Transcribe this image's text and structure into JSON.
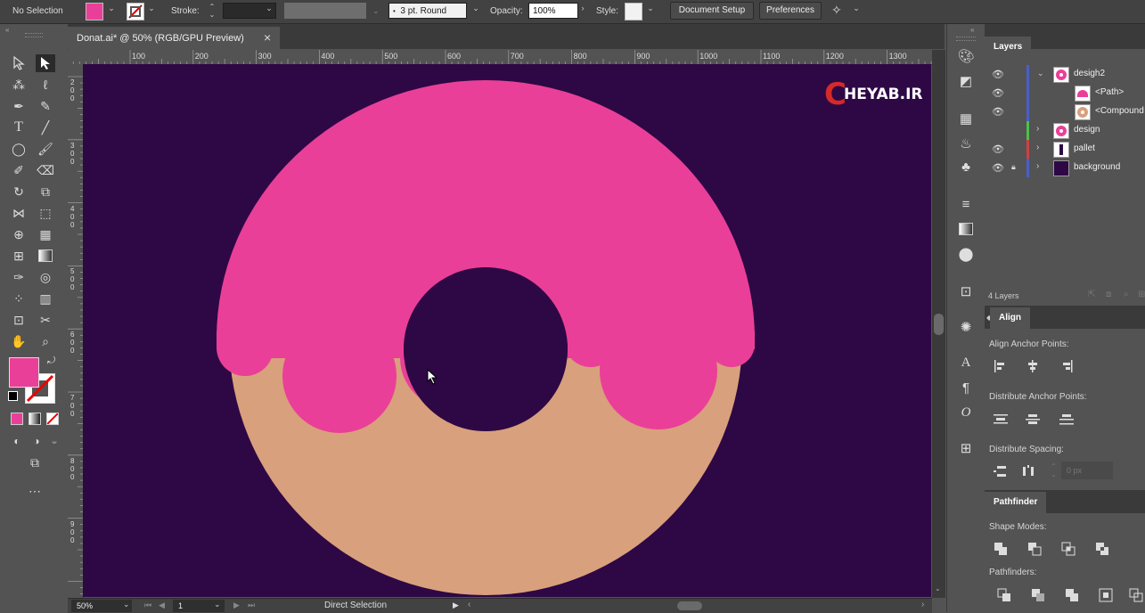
{
  "control_bar": {
    "selection_label": "No Selection",
    "stroke_label": "Stroke:",
    "brush_value": "3 pt. Round",
    "opacity_label": "Opacity:",
    "opacity_value": "100%",
    "style_label": "Style:",
    "document_setup": "Document Setup",
    "preferences": "Preferences",
    "fill_color": "#ea3f98"
  },
  "document_tab": {
    "title": "Donat.ai* @ 50% (RGB/GPU Preview)",
    "close": "×"
  },
  "ruler_top": [
    "100",
    "200",
    "300",
    "400",
    "500",
    "600",
    "700",
    "800",
    "900",
    "1000",
    "1100",
    "1200",
    "1300"
  ],
  "ruler_left": [
    "2\n0\n0",
    "3\n0\n0",
    "4\n0\n0",
    "5\n0\n0",
    "6\n0\n0",
    "7\n0\n0",
    "8\n0\n0",
    "9\n0\n0"
  ],
  "artboard": {
    "background": "#2e0845",
    "icing_color": "#ea3f98",
    "dough_color": "#d8a07c",
    "watermark_letter": "C",
    "watermark_text": "HEYAB.IR"
  },
  "status_bar": {
    "zoom": "50%",
    "artboard_num": "1",
    "tool": "Direct Selection"
  },
  "layers_panel": {
    "tab": "Layers",
    "rows": [
      {
        "name": "desigh2",
        "expanded": true,
        "color": "#4a5ec8"
      },
      {
        "name": "<Path>",
        "sub": true,
        "color": "#4a5ec8"
      },
      {
        "name": "<Compound",
        "sub": true,
        "color": "#4a5ec8"
      },
      {
        "name": "design",
        "color": "#4cc04c"
      },
      {
        "name": "pallet",
        "color": "#d04040"
      },
      {
        "name": "background",
        "color": "#4a5ec8",
        "locked": true
      }
    ],
    "count": "4 Layers"
  },
  "align_panel": {
    "tab": "Align",
    "anchor_label": "Align Anchor Points:",
    "distribute_anchor_label": "Distribute Anchor Points:",
    "distribute_spacing_label": "Distribute Spacing:",
    "spacing_value": "0 px"
  },
  "pathfinder_panel": {
    "tab": "Pathfinder",
    "shape_modes_label": "Shape Modes:",
    "pathfinders_label": "Pathfinders:"
  }
}
